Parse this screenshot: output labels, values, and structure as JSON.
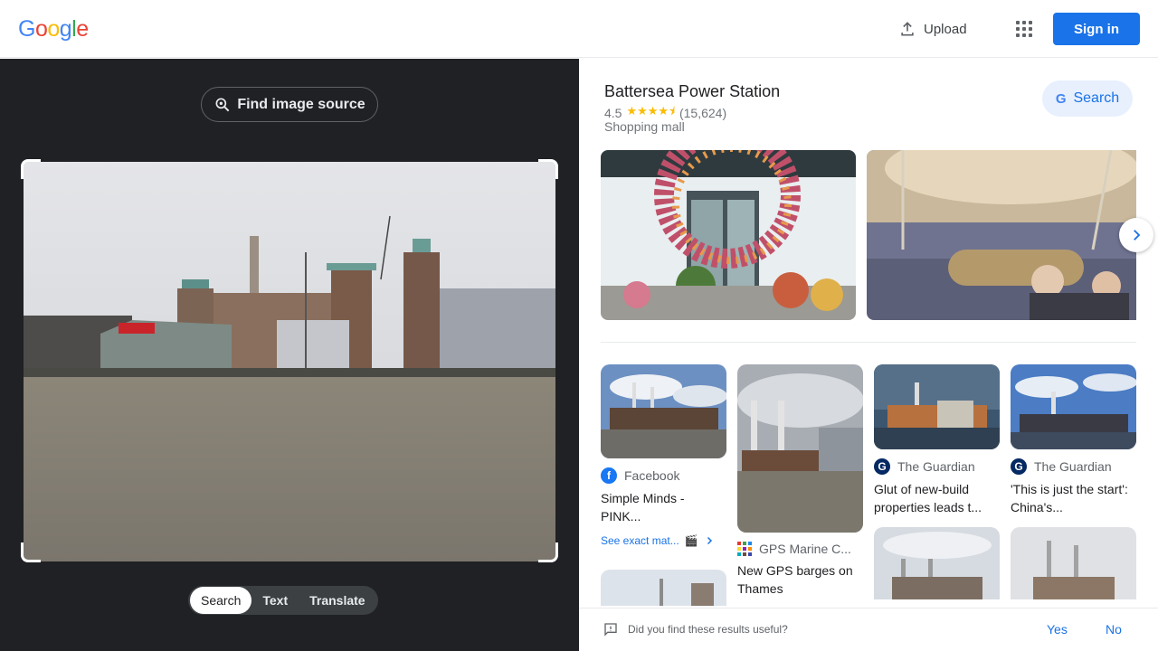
{
  "header": {
    "logo_letters": [
      {
        "ch": "G",
        "color": "#4285f4"
      },
      {
        "ch": "o",
        "color": "#ea4335"
      },
      {
        "ch": "o",
        "color": "#fbbc05"
      },
      {
        "ch": "g",
        "color": "#4285f4"
      },
      {
        "ch": "l",
        "color": "#34a853"
      },
      {
        "ch": "e",
        "color": "#ea4335"
      }
    ],
    "upload_label": "Upload",
    "apps_icon": "apps-grid-icon",
    "signin_label": "Sign in"
  },
  "left_panel": {
    "find_source_label": "Find image source",
    "modes": [
      {
        "label": "Search",
        "active": true
      },
      {
        "label": "Text",
        "active": false
      },
      {
        "label": "Translate",
        "active": false
      }
    ]
  },
  "knowledge_panel": {
    "title": "Battersea Power Station",
    "rating": "4.5",
    "stars": "★★★★⯨",
    "reviews": "(15,624)",
    "type": "Shopping mall",
    "search_label": "Search"
  },
  "results": [
    {
      "source": "Facebook",
      "source_color": "#1877f2",
      "source_icon": "f",
      "caption": "Simple Minds - PINK...",
      "exact_match": "See exact mat..."
    },
    {
      "source": "GPS Marine C...",
      "source_color": "multi",
      "source_icon": "",
      "caption": "New GPS barges on Thames"
    },
    {
      "source": "The Guardian",
      "source_color": "#052962",
      "source_icon": "G",
      "caption": "Glut of new-build properties leads t..."
    },
    {
      "source": "The Guardian",
      "source_color": "#052962",
      "source_icon": "G",
      "caption": "'This is just the start': China's..."
    }
  ],
  "feedback": {
    "question": "Did you find these results useful?",
    "yes": "Yes",
    "no": "No"
  }
}
